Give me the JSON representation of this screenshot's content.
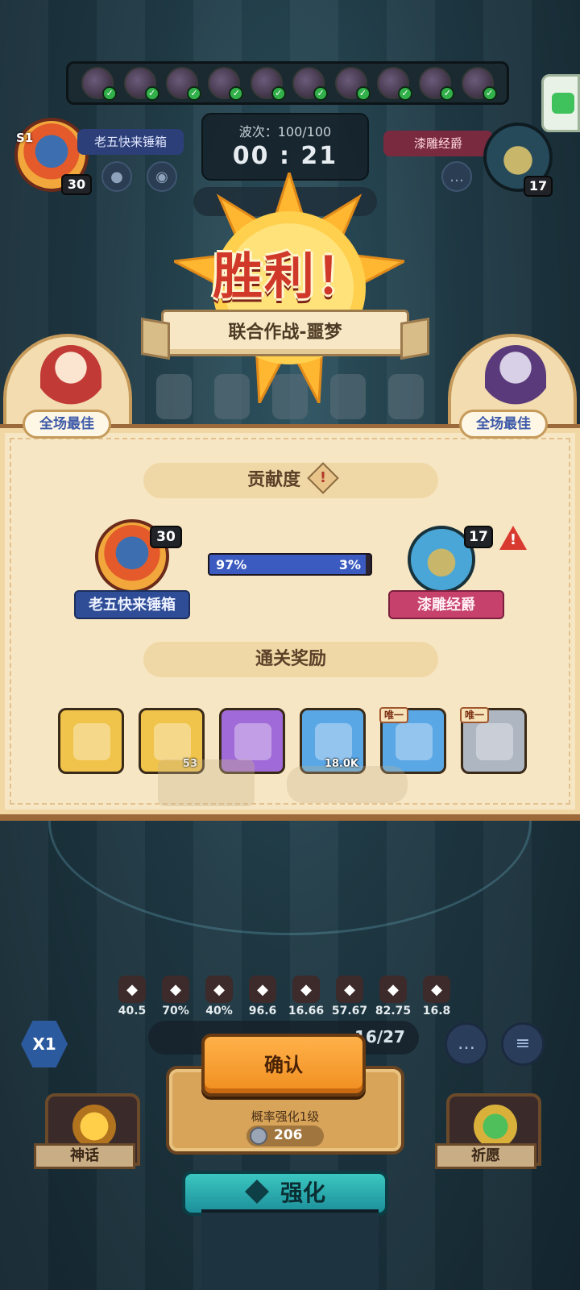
{
  "hero_strip": {
    "slot_count": 10,
    "check_glyph": "✓"
  },
  "player_left": {
    "name": "老五快来锤箱",
    "season_badge": "S1",
    "level": "30",
    "mic_icon": "microphone-icon",
    "speaker_icon": "speaker-icon"
  },
  "player_right": {
    "name": "漆雕经爵",
    "level": "17",
    "chat_icon": "chat-bubble-icon"
  },
  "match": {
    "wave_label": "波次：100/100",
    "timer": "00 : 21"
  },
  "result": {
    "title": "胜利！",
    "mode": "联合作战-噩梦"
  },
  "mvp": {
    "left_label": "全场最佳",
    "right_label": "全场最佳"
  },
  "contribution": {
    "section_title": "贡献度",
    "info_glyph": "!",
    "left_percent": "97%",
    "right_percent": "3%",
    "left_fraction": 0.97,
    "warning_glyph": "!"
  },
  "rewards": {
    "section_title": "通关奖励",
    "items": [
      {
        "name": "gold-chest",
        "count": "",
        "tag": "",
        "color": "#f0c34a"
      },
      {
        "name": "gold-key",
        "count": "53",
        "tag": "",
        "color": "#f0c34a"
      },
      {
        "name": "purple-chest",
        "count": "",
        "tag": "",
        "color": "#a06ad8"
      },
      {
        "name": "gold-coin",
        "count": "18.0K",
        "tag": "",
        "color": "#5aa7e6"
      },
      {
        "name": "blue-emblem",
        "count": "",
        "tag": "唯一",
        "color": "#5aa7e6"
      },
      {
        "name": "silver-emblem",
        "count": "",
        "tag": "唯一",
        "color": "#aeb6c2"
      }
    ]
  },
  "stats": [
    {
      "icon": "attack-icon",
      "value": "40.5"
    },
    {
      "icon": "heart-icon",
      "value": "70%"
    },
    {
      "icon": "house-icon",
      "value": "40%"
    },
    {
      "icon": "crit-icon",
      "value": "96.6"
    },
    {
      "icon": "heart-break-icon",
      "value": "16.66"
    },
    {
      "icon": "sword-up-icon",
      "value": "57.67"
    },
    {
      "icon": "fist-up-icon",
      "value": "82.75"
    },
    {
      "icon": "gear-up-icon",
      "value": "16.8"
    }
  ],
  "controls": {
    "speed": "X1",
    "unit_count": "16/27",
    "confirm": "确认",
    "upgrade_desc": "概率强化1级",
    "upgrade_cost": "206",
    "myth": "神话",
    "wish": "祈愿",
    "enhance": "强化"
  },
  "colors": {
    "panel": "#f7e6c3",
    "victory_red": "#d0392a",
    "player_blue": "#2f4d97",
    "player_pink": "#c7416d",
    "confirm_orange": "#f08e1f",
    "enhance_teal": "#1c8f9a"
  }
}
